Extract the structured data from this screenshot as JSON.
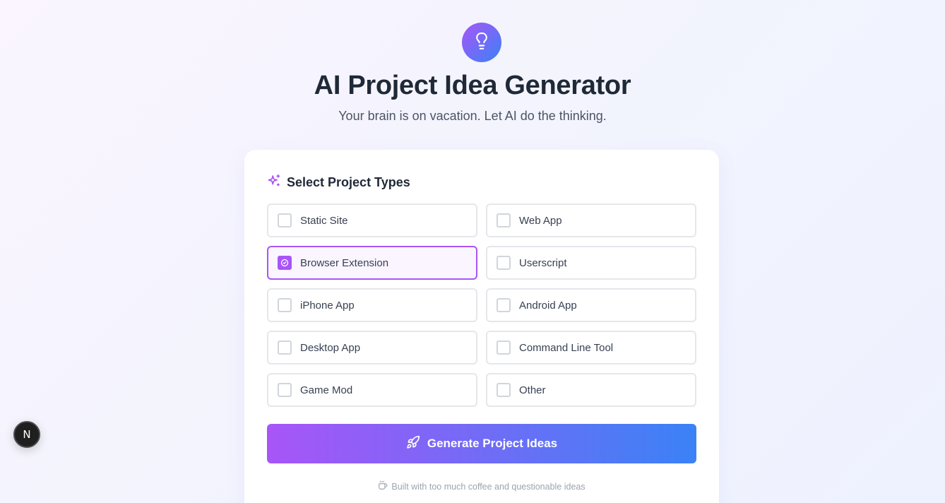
{
  "header": {
    "logo_icon": "lightbulb-icon",
    "title": "AI Project Idea Generator",
    "subtitle": "Your brain is on vacation. Let AI do the thinking."
  },
  "card": {
    "section_icon": "sparkles-icon",
    "section_title": "Select Project Types",
    "options": [
      {
        "label": "Static Site",
        "checked": false
      },
      {
        "label": "Web App",
        "checked": false
      },
      {
        "label": "Browser Extension",
        "checked": true
      },
      {
        "label": "Userscript",
        "checked": false
      },
      {
        "label": "iPhone App",
        "checked": false
      },
      {
        "label": "Android App",
        "checked": false
      },
      {
        "label": "Desktop App",
        "checked": false
      },
      {
        "label": "Command Line Tool",
        "checked": false
      },
      {
        "label": "Game Mod",
        "checked": false
      },
      {
        "label": "Other",
        "checked": false
      }
    ],
    "generate_label": "Generate Project Ideas",
    "generate_icon": "rocket-icon",
    "footer_icon": "coffee-icon",
    "footer_text": "Built with too much coffee and questionable ideas"
  },
  "dev_badge": {
    "label": "N"
  },
  "colors": {
    "accent_purple": "#a855f7",
    "accent_blue": "#3b82f6",
    "text_dark": "#1f2937"
  }
}
